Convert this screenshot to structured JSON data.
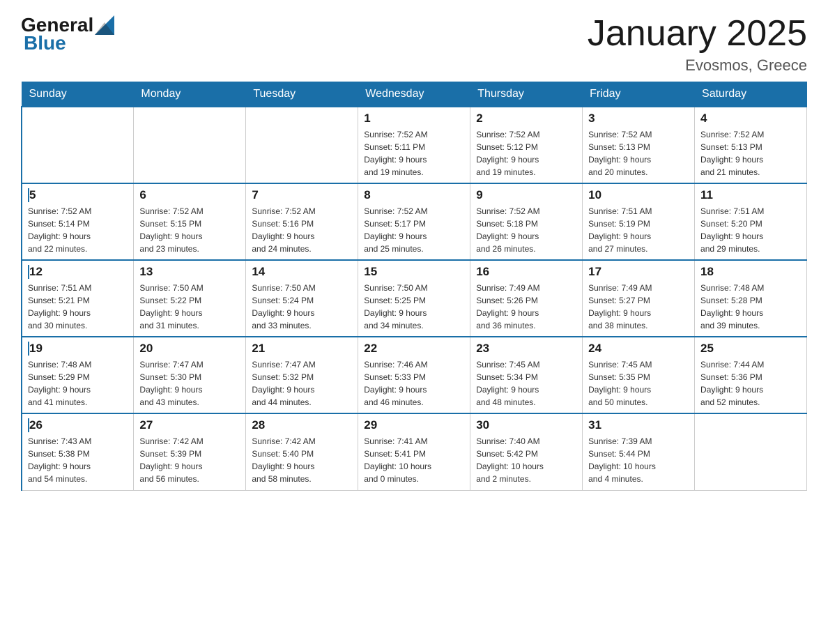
{
  "logo": {
    "general": "General",
    "blue": "Blue"
  },
  "title": "January 2025",
  "subtitle": "Evosmos, Greece",
  "days_of_week": [
    "Sunday",
    "Monday",
    "Tuesday",
    "Wednesday",
    "Thursday",
    "Friday",
    "Saturday"
  ],
  "weeks": [
    [
      {
        "day": "",
        "info": ""
      },
      {
        "day": "",
        "info": ""
      },
      {
        "day": "",
        "info": ""
      },
      {
        "day": "1",
        "info": "Sunrise: 7:52 AM\nSunset: 5:11 PM\nDaylight: 9 hours\nand 19 minutes."
      },
      {
        "day": "2",
        "info": "Sunrise: 7:52 AM\nSunset: 5:12 PM\nDaylight: 9 hours\nand 19 minutes."
      },
      {
        "day": "3",
        "info": "Sunrise: 7:52 AM\nSunset: 5:13 PM\nDaylight: 9 hours\nand 20 minutes."
      },
      {
        "day": "4",
        "info": "Sunrise: 7:52 AM\nSunset: 5:13 PM\nDaylight: 9 hours\nand 21 minutes."
      }
    ],
    [
      {
        "day": "5",
        "info": "Sunrise: 7:52 AM\nSunset: 5:14 PM\nDaylight: 9 hours\nand 22 minutes."
      },
      {
        "day": "6",
        "info": "Sunrise: 7:52 AM\nSunset: 5:15 PM\nDaylight: 9 hours\nand 23 minutes."
      },
      {
        "day": "7",
        "info": "Sunrise: 7:52 AM\nSunset: 5:16 PM\nDaylight: 9 hours\nand 24 minutes."
      },
      {
        "day": "8",
        "info": "Sunrise: 7:52 AM\nSunset: 5:17 PM\nDaylight: 9 hours\nand 25 minutes."
      },
      {
        "day": "9",
        "info": "Sunrise: 7:52 AM\nSunset: 5:18 PM\nDaylight: 9 hours\nand 26 minutes."
      },
      {
        "day": "10",
        "info": "Sunrise: 7:51 AM\nSunset: 5:19 PM\nDaylight: 9 hours\nand 27 minutes."
      },
      {
        "day": "11",
        "info": "Sunrise: 7:51 AM\nSunset: 5:20 PM\nDaylight: 9 hours\nand 29 minutes."
      }
    ],
    [
      {
        "day": "12",
        "info": "Sunrise: 7:51 AM\nSunset: 5:21 PM\nDaylight: 9 hours\nand 30 minutes."
      },
      {
        "day": "13",
        "info": "Sunrise: 7:50 AM\nSunset: 5:22 PM\nDaylight: 9 hours\nand 31 minutes."
      },
      {
        "day": "14",
        "info": "Sunrise: 7:50 AM\nSunset: 5:24 PM\nDaylight: 9 hours\nand 33 minutes."
      },
      {
        "day": "15",
        "info": "Sunrise: 7:50 AM\nSunset: 5:25 PM\nDaylight: 9 hours\nand 34 minutes."
      },
      {
        "day": "16",
        "info": "Sunrise: 7:49 AM\nSunset: 5:26 PM\nDaylight: 9 hours\nand 36 minutes."
      },
      {
        "day": "17",
        "info": "Sunrise: 7:49 AM\nSunset: 5:27 PM\nDaylight: 9 hours\nand 38 minutes."
      },
      {
        "day": "18",
        "info": "Sunrise: 7:48 AM\nSunset: 5:28 PM\nDaylight: 9 hours\nand 39 minutes."
      }
    ],
    [
      {
        "day": "19",
        "info": "Sunrise: 7:48 AM\nSunset: 5:29 PM\nDaylight: 9 hours\nand 41 minutes."
      },
      {
        "day": "20",
        "info": "Sunrise: 7:47 AM\nSunset: 5:30 PM\nDaylight: 9 hours\nand 43 minutes."
      },
      {
        "day": "21",
        "info": "Sunrise: 7:47 AM\nSunset: 5:32 PM\nDaylight: 9 hours\nand 44 minutes."
      },
      {
        "day": "22",
        "info": "Sunrise: 7:46 AM\nSunset: 5:33 PM\nDaylight: 9 hours\nand 46 minutes."
      },
      {
        "day": "23",
        "info": "Sunrise: 7:45 AM\nSunset: 5:34 PM\nDaylight: 9 hours\nand 48 minutes."
      },
      {
        "day": "24",
        "info": "Sunrise: 7:45 AM\nSunset: 5:35 PM\nDaylight: 9 hours\nand 50 minutes."
      },
      {
        "day": "25",
        "info": "Sunrise: 7:44 AM\nSunset: 5:36 PM\nDaylight: 9 hours\nand 52 minutes."
      }
    ],
    [
      {
        "day": "26",
        "info": "Sunrise: 7:43 AM\nSunset: 5:38 PM\nDaylight: 9 hours\nand 54 minutes."
      },
      {
        "day": "27",
        "info": "Sunrise: 7:42 AM\nSunset: 5:39 PM\nDaylight: 9 hours\nand 56 minutes."
      },
      {
        "day": "28",
        "info": "Sunrise: 7:42 AM\nSunset: 5:40 PM\nDaylight: 9 hours\nand 58 minutes."
      },
      {
        "day": "29",
        "info": "Sunrise: 7:41 AM\nSunset: 5:41 PM\nDaylight: 10 hours\nand 0 minutes."
      },
      {
        "day": "30",
        "info": "Sunrise: 7:40 AM\nSunset: 5:42 PM\nDaylight: 10 hours\nand 2 minutes."
      },
      {
        "day": "31",
        "info": "Sunrise: 7:39 AM\nSunset: 5:44 PM\nDaylight: 10 hours\nand 4 minutes."
      },
      {
        "day": "",
        "info": ""
      }
    ]
  ]
}
